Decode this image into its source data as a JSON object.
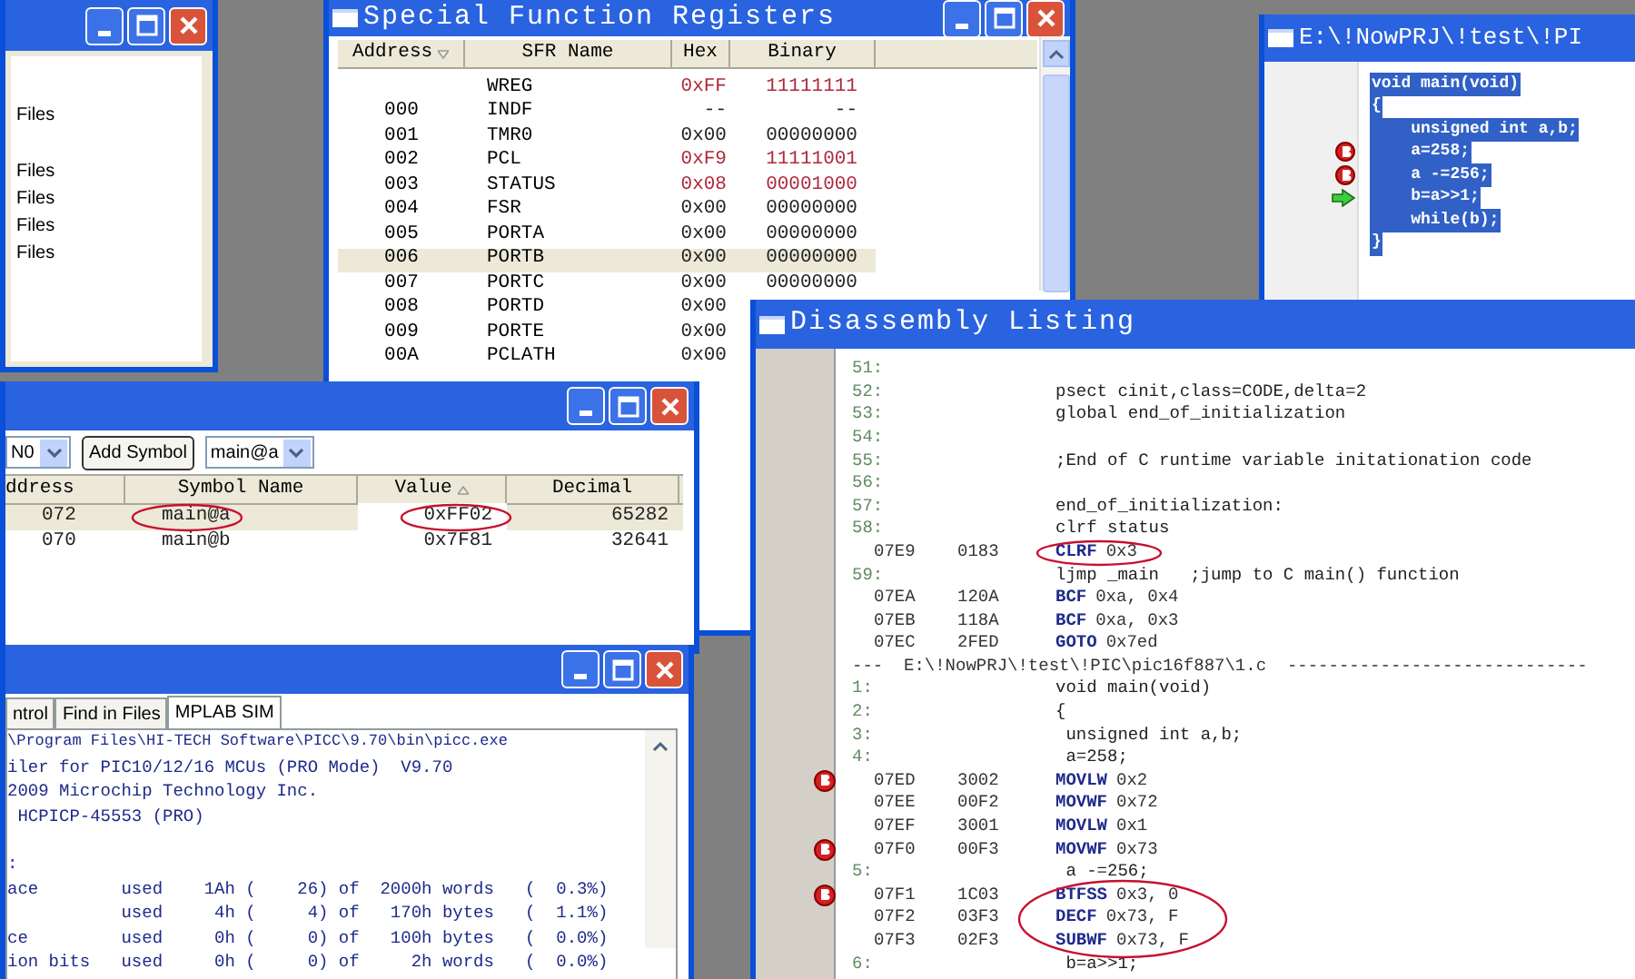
{
  "explorer_window": {
    "items": [
      {
        "label": "Files"
      },
      {
        "label": "Files"
      },
      {
        "label": "Files"
      },
      {
        "label": "Files"
      },
      {
        "label": "Files"
      }
    ]
  },
  "sfr_window": {
    "title": "Special Function Registers",
    "columns": [
      "Address",
      "SFR Name",
      "Hex",
      "Binary"
    ],
    "rows": [
      {
        "address": "",
        "name": "WREG",
        "hex": "0xFF",
        "binary": "11111111",
        "changed": true,
        "selected": false
      },
      {
        "address": "000",
        "name": "INDF",
        "hex": "--",
        "binary": "--",
        "changed": false,
        "selected": false
      },
      {
        "address": "001",
        "name": "TMR0",
        "hex": "0x00",
        "binary": "00000000",
        "changed": false,
        "selected": false
      },
      {
        "address": "002",
        "name": "PCL",
        "hex": "0xF9",
        "binary": "11111001",
        "changed": true,
        "selected": false
      },
      {
        "address": "003",
        "name": "STATUS",
        "hex": "0x08",
        "binary": "00001000",
        "changed": true,
        "selected": false
      },
      {
        "address": "004",
        "name": "FSR",
        "hex": "0x00",
        "binary": "00000000",
        "changed": false,
        "selected": false
      },
      {
        "address": "005",
        "name": "PORTA",
        "hex": "0x00",
        "binary": "00000000",
        "changed": false,
        "selected": false
      },
      {
        "address": "006",
        "name": "PORTB",
        "hex": "0x00",
        "binary": "00000000",
        "changed": false,
        "selected": true
      },
      {
        "address": "007",
        "name": "PORTC",
        "hex": "0x00",
        "binary": "00000000",
        "changed": false,
        "selected": false
      },
      {
        "address": "008",
        "name": "PORTD",
        "hex": "0x00",
        "changed": false,
        "selected": false
      },
      {
        "address": "009",
        "name": "PORTE",
        "hex": "0x00",
        "changed": false,
        "selected": false
      },
      {
        "address": "00A",
        "name": "PCLATH",
        "hex": "0x00",
        "changed": false,
        "selected": false
      }
    ]
  },
  "editor_window": {
    "title": "E:\\!NowPRJ\\!test\\!PI",
    "lines": [
      {
        "text": "void main(void)",
        "breakpoint": false,
        "current": false
      },
      {
        "text": "{",
        "breakpoint": false,
        "current": false
      },
      {
        "text": "    unsigned int a,b;",
        "breakpoint": false,
        "current": false
      },
      {
        "text": "    a=258;",
        "breakpoint": true,
        "current": false
      },
      {
        "text": "    a -=256;",
        "breakpoint": true,
        "current": false
      },
      {
        "text": "    b=a>>1;",
        "breakpoint": false,
        "current": true
      },
      {
        "text": "    while(b);",
        "breakpoint": false,
        "current": false
      },
      {
        "text": "}",
        "breakpoint": false,
        "current": false
      }
    ]
  },
  "watch_window": {
    "toolbar": {
      "bank_dropdown": "N0",
      "add_button": "Add Symbol",
      "symbol_dropdown": "main@a"
    },
    "columns": [
      "ddress",
      "Symbol Name",
      "Value",
      "Decimal"
    ],
    "rows": [
      {
        "address": "072",
        "symbol": "main@a",
        "value": "0xFF02",
        "decimal": "65282",
        "selected": true
      },
      {
        "address": "070",
        "symbol": "main@b",
        "value": "0x7F81",
        "decimal": "32641",
        "selected": false
      }
    ]
  },
  "output_window": {
    "tabs": [
      {
        "label": "ntrol",
        "selected": false
      },
      {
        "label": "Find in Files",
        "selected": false
      },
      {
        "label": "MPLAB SIM",
        "selected": true
      }
    ],
    "lines": [
      "\\Program Files\\HI-TECH Software\\PICC\\9.70\\bin\\picc.exe",
      "iler for PIC10/12/16 MCUs (PRO Mode)  V9.70",
      "2009 Microchip Technology Inc.",
      " HCPICP-45553 (PRO)",
      ":",
      "ace        used    1Ah (    26) of  2000h words   (  0.3%)",
      "           used     4h (     4) of   170h bytes   (  1.1%)",
      "ce         used     0h (     0) of   100h bytes   (  0.0%)",
      "ion bits   used     0h (     0) of     2h words   (  0.0%)"
    ]
  },
  "disassembly_window": {
    "title": "Disassembly Listing",
    "lines": [
      {
        "kind": "source",
        "number": "51:"
      },
      {
        "kind": "source",
        "number": "52:",
        "text": "psect cinit,class=CODE,delta=2"
      },
      {
        "kind": "source",
        "number": "53:",
        "text": "global end_of_initialization"
      },
      {
        "kind": "source",
        "number": "54:"
      },
      {
        "kind": "source",
        "number": "55:",
        "text": ";End of C runtime variable initationation code"
      },
      {
        "kind": "source",
        "number": "56:"
      },
      {
        "kind": "source",
        "number": "57:",
        "text": "end_of_initialization:"
      },
      {
        "kind": "source",
        "number": "58:",
        "text": "clrf status"
      },
      {
        "kind": "instruction",
        "address": "07E9",
        "opcode": "0183",
        "mnemonic": "CLRF",
        "operand": "0x3",
        "breakpoint": false
      },
      {
        "kind": "source",
        "number": "59:",
        "text": "ljmp _main   ;jump to C main() function"
      },
      {
        "kind": "instruction",
        "address": "07EA",
        "opcode": "120A",
        "mnemonic": "BCF",
        "operand": "0xa, 0x4",
        "breakpoint": false
      },
      {
        "kind": "instruction",
        "address": "07EB",
        "opcode": "118A",
        "mnemonic": "BCF",
        "operand": "0xa, 0x3",
        "breakpoint": false
      },
      {
        "kind": "instruction",
        "address": "07EC",
        "opcode": "2FED",
        "mnemonic": "GOTO",
        "operand": "0x7ed",
        "breakpoint": false
      },
      {
        "kind": "file",
        "text": "---  E:\\!NowPRJ\\!test\\!PIC\\pic16f887\\1.c  -----------------------------"
      },
      {
        "kind": "source",
        "number": "1:",
        "text": "void main(void)"
      },
      {
        "kind": "source",
        "number": "2:",
        "text": "{"
      },
      {
        "kind": "source",
        "number": "3:",
        "text": " unsigned int a,b;"
      },
      {
        "kind": "source",
        "number": "4:",
        "text": " a=258;"
      },
      {
        "kind": "instruction",
        "address": "07ED",
        "opcode": "3002",
        "mnemonic": "MOVLW",
        "operand": "0x2",
        "breakpoint": true
      },
      {
        "kind": "instruction",
        "address": "07EE",
        "opcode": "00F2",
        "mnemonic": "MOVWF",
        "operand": "0x72",
        "breakpoint": false
      },
      {
        "kind": "instruction",
        "address": "07EF",
        "opcode": "3001",
        "mnemonic": "MOVLW",
        "operand": "0x1",
        "breakpoint": false
      },
      {
        "kind": "instruction",
        "address": "07F0",
        "opcode": "00F3",
        "mnemonic": "MOVWF",
        "operand": "0x73",
        "breakpoint": true
      },
      {
        "kind": "source",
        "number": "5:",
        "text": " a -=256;"
      },
      {
        "kind": "instruction",
        "address": "07F1",
        "opcode": "1C03",
        "mnemonic": "BTFSS",
        "operand": "0x3, 0",
        "breakpoint": true
      },
      {
        "kind": "instruction",
        "address": "07F2",
        "opcode": "03F3",
        "mnemonic": "DECF",
        "operand": "0x73, F",
        "breakpoint": false
      },
      {
        "kind": "instruction",
        "address": "07F3",
        "opcode": "02F3",
        "mnemonic": "SUBWF",
        "operand": "0x73, F",
        "breakpoint": false
      },
      {
        "kind": "source",
        "number": "6:",
        "text": " b=a>>1;"
      }
    ]
  }
}
